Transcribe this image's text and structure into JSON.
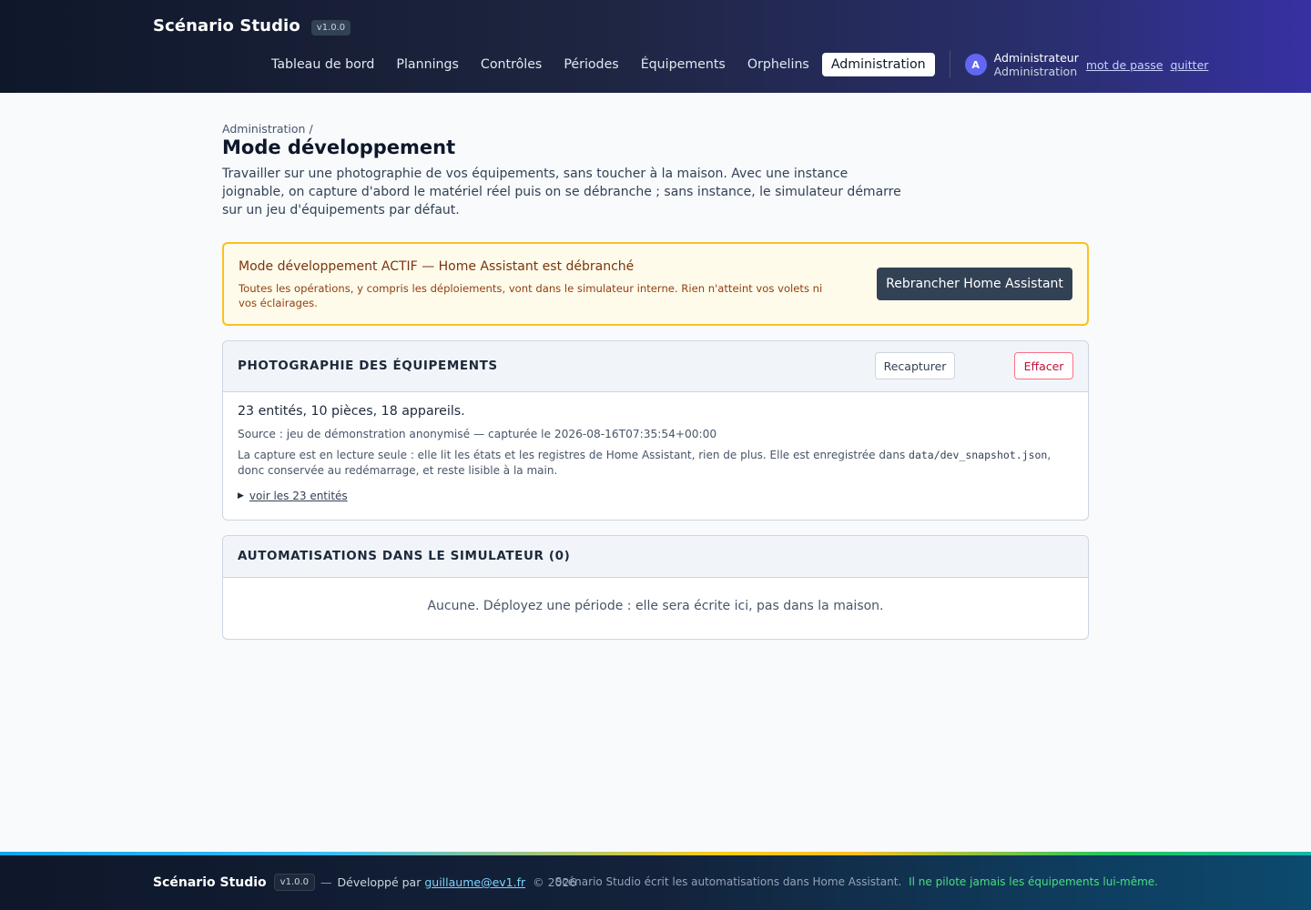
{
  "app": {
    "name": "Scénario Studio",
    "version": "v1.0.0"
  },
  "nav": {
    "items": [
      {
        "label": "Tableau de bord"
      },
      {
        "label": "Plannings"
      },
      {
        "label": "Contrôles"
      },
      {
        "label": "Périodes"
      },
      {
        "label": "Équipements"
      },
      {
        "label": "Orphelins"
      },
      {
        "label": "Administration",
        "active": true
      }
    ]
  },
  "user": {
    "initial": "A",
    "name": "Administrateur",
    "role": "Administration",
    "password_link": "mot de passe",
    "logout_link": "quitter"
  },
  "page": {
    "breadcrumb": "Administration /",
    "title": "Mode développement",
    "intro": "Travailler sur une photographie de vos équipements, sans toucher à la maison. Avec une instance joignable, on capture d'abord le matériel réel puis on se débranche ; sans instance, le simulateur démarre sur un jeu d'équipements par défaut."
  },
  "alert": {
    "title": "Mode développement ACTIF — Home Assistant est débranché",
    "text": "Toutes les opérations, y compris les déploiements, vont dans le simulateur interne. Rien n'atteint vos volets ni vos éclairages.",
    "button": "Rebrancher Home Assistant"
  },
  "snapshot": {
    "title": "PHOTOGRAPHIE DES ÉQUIPEMENTS",
    "recapture_label": "Recapturer",
    "clear_label": "Effacer",
    "summary": "23 entités, 10 pièces, 18 appareils.",
    "source": "Source : jeu de démonstration anonymisé — capturée le 2026-08-16T07:35:54+00:00",
    "note_before": "La capture est en lecture seule : elle lit les états et les registres de Home Assistant, rien de plus. Elle est enregistrée dans ",
    "note_file": "data/dev_snapshot.json",
    "note_after": ", donc conservée au redémarrage, et reste lisible à la main.",
    "details_label": "voir les 23 entités"
  },
  "automations": {
    "title": "AUTOMATISATIONS DANS LE SIMULATEUR (0)",
    "empty": "Aucune. Déployez une période : elle sera écrite ici, pas dans la maison."
  },
  "footer": {
    "brand": "Scénario Studio",
    "version": "v1.0.0",
    "dash": "—",
    "dev_by": "Développé par",
    "email": "guillaume@ev1.fr",
    "copyright": "© 2026",
    "note": "Scénario Studio écrit les automatisations dans Home Assistant.",
    "highlight": "Il ne pilote jamais les équipements lui-même."
  },
  "colors": {
    "accent": "#6366f1",
    "alert_border": "#fbbf24",
    "alert_bg": "#fffbeb",
    "danger": "#be123c",
    "footer_highlight": "#4ade80"
  }
}
